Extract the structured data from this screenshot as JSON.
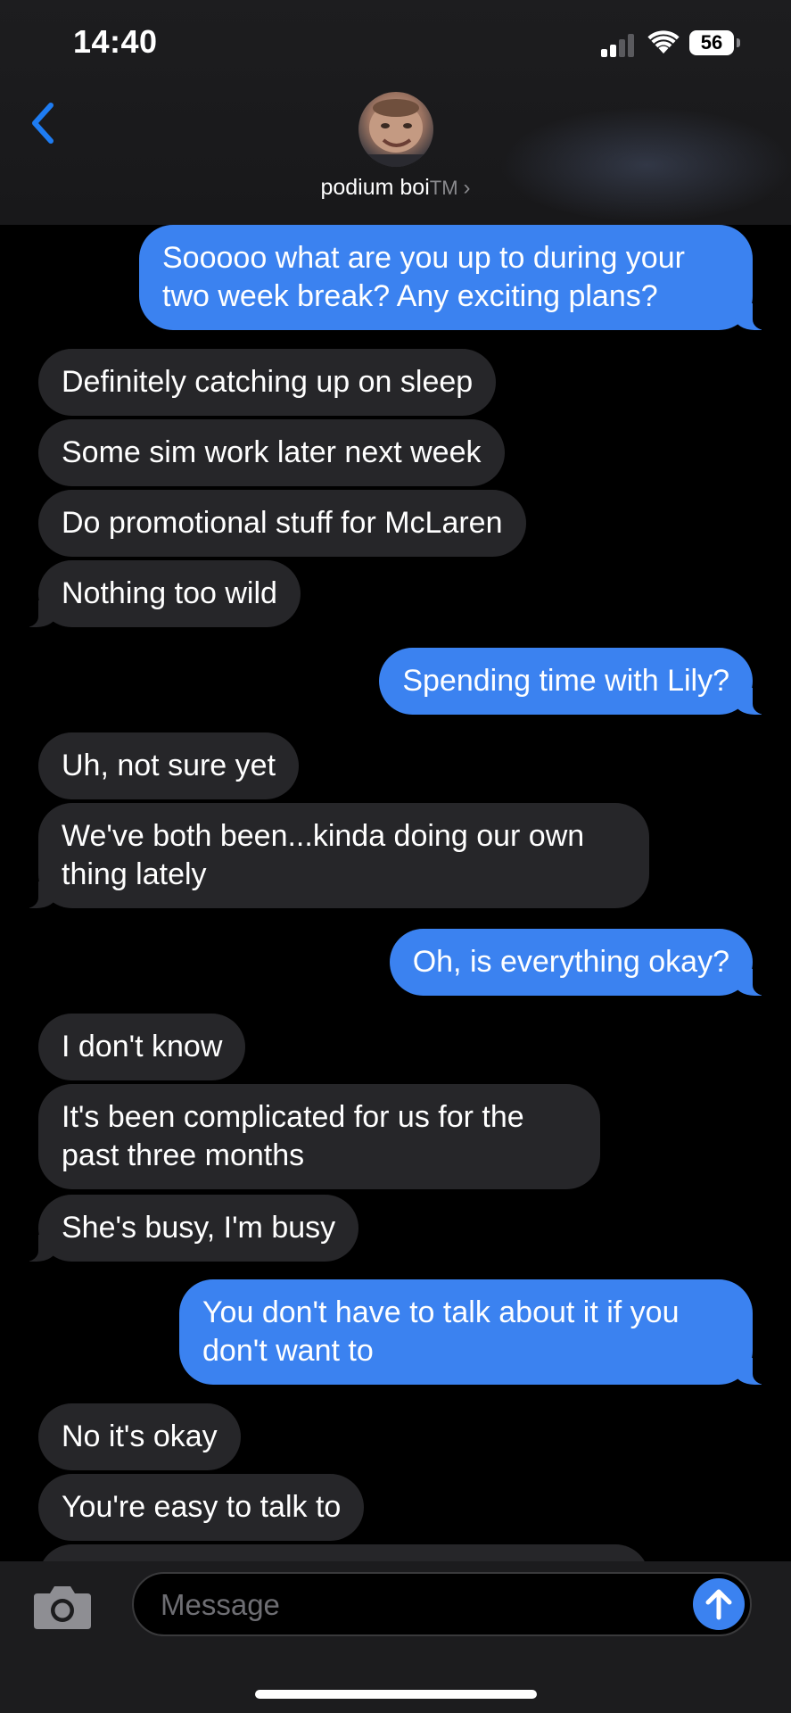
{
  "status_bar": {
    "time": "14:40",
    "battery": "56"
  },
  "header": {
    "contact_name": "podium boi",
    "contact_suffix": "TM",
    "chevron": "›",
    "back_icon": "chevron-left-icon",
    "avatar_icon": "contact-avatar"
  },
  "messages": [
    {
      "side": "out",
      "text": "Sooooo what are you up to during your two week break? Any exciting plans?"
    },
    {
      "side": "in",
      "text": "Definitely catching up on sleep"
    },
    {
      "side": "in",
      "text": "Some sim work later next week"
    },
    {
      "side": "in",
      "text": "Do promotional stuff for McLaren"
    },
    {
      "side": "in",
      "text": "Nothing too wild"
    },
    {
      "side": "out",
      "text": "Spending time with Lily?"
    },
    {
      "side": "in",
      "text": "Uh, not sure yet"
    },
    {
      "side": "in",
      "text": "We've both been...kinda doing our own thing lately"
    },
    {
      "side": "out",
      "text": "Oh, is everything okay?"
    },
    {
      "side": "in",
      "text": "I don't know"
    },
    {
      "side": "in",
      "text": "It's been complicated for us for the past three months"
    },
    {
      "side": "in",
      "text": "She's busy, I'm busy"
    },
    {
      "side": "out",
      "text": "You don't have to talk about it if you don't want to"
    },
    {
      "side": "in",
      "text": "No it's okay"
    },
    {
      "side": "in",
      "text": "You're easy to talk to"
    }
  ],
  "composer": {
    "placeholder": "Message",
    "camera_icon": "camera-icon",
    "send_icon": "send-arrow-up-icon"
  },
  "colors": {
    "outgoing_bubble": "#3b82f0",
    "incoming_bubble": "#262629",
    "accent": "#1e7cf2"
  }
}
